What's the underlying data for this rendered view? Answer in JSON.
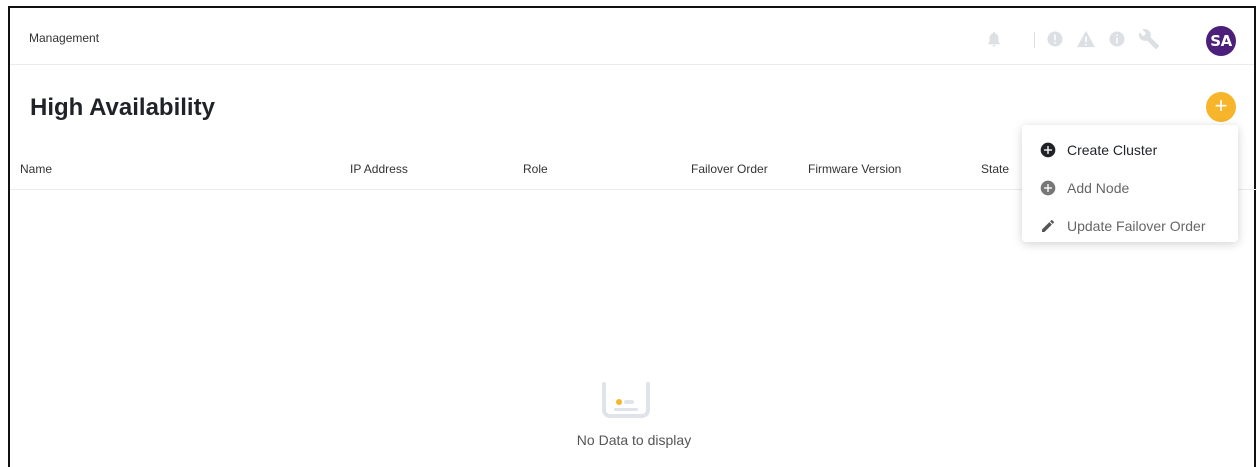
{
  "header": {
    "breadcrumb": "Management",
    "avatar_initials": "SA",
    "icons": [
      "bell-icon",
      "error-circle-icon",
      "warning-triangle-icon",
      "info-circle-icon",
      "wrench-icon"
    ]
  },
  "page": {
    "title": "High Availability",
    "add_button_symbol": "+"
  },
  "table": {
    "columns": [
      "Name",
      "IP Address",
      "Role",
      "Failover Order",
      "Firmware Version",
      "State"
    ]
  },
  "empty_state": {
    "text": "No Data to display"
  },
  "menu": {
    "items": [
      {
        "label": "Create Cluster",
        "icon": "plus-circle-icon",
        "enabled": true
      },
      {
        "label": "Add Node",
        "icon": "plus-circle-icon",
        "enabled": false
      },
      {
        "label": "Update Failover Order",
        "icon": "pencil-icon",
        "enabled": false
      }
    ]
  },
  "colors": {
    "accent": "#f7b52c",
    "avatar": "#4b1f7a"
  }
}
